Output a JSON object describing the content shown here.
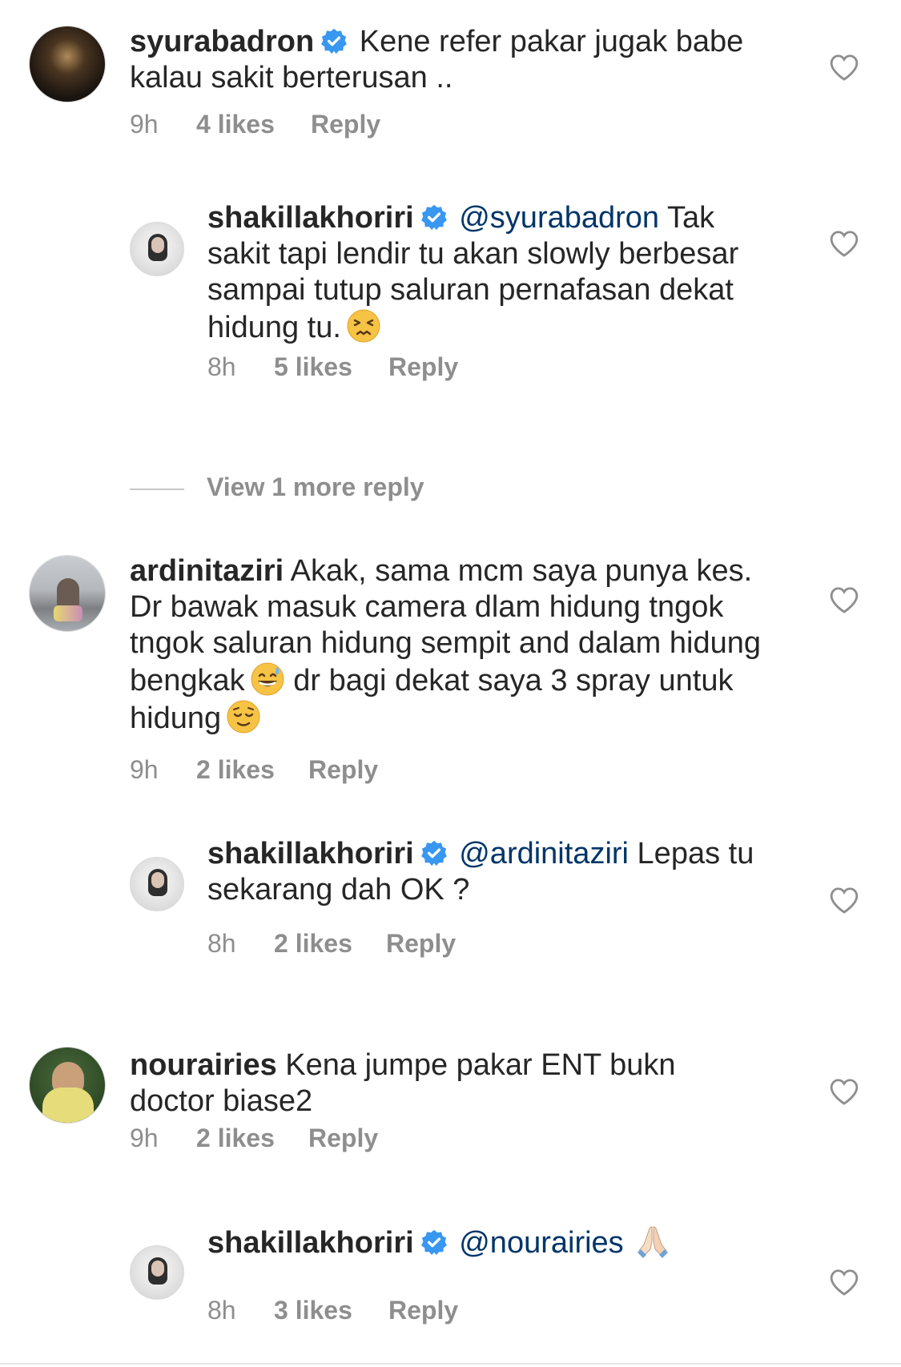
{
  "comments": [
    {
      "id": "c1",
      "level": "top",
      "username": "syurabadron",
      "verified": true,
      "mention": "",
      "text": "Kene refer pakar jugak babe kalau sakit berterusan ..",
      "emoji": "",
      "time": "9h",
      "likes": "4 likes",
      "reply": "Reply",
      "avatar_color": "#2a2118"
    },
    {
      "id": "c2",
      "level": "reply",
      "username": "shakillakhoriri",
      "verified": true,
      "mention": "@syurabadron",
      "text": "Tak sakit tapi lendir tu akan slowly berbesar sampai tutup saluran pernafasan dekat hidung tu.",
      "emoji": "persevering-face",
      "time": "8h",
      "likes": "5 likes",
      "reply": "Reply",
      "avatar_color": "#9a9a9a"
    },
    {
      "id": "c3",
      "level": "top",
      "username": "ardinitaziri",
      "verified": false,
      "mention": "",
      "text": "Akak, sama mcm saya punya kes. Dr bawak masuk camera dlam hidung tngok tngok saluran hidung sempit and dalam hidung bengkak",
      "emoji": "grinning-sweat-face",
      "text2": "dr bagi dekat saya 3 spray untuk hidung",
      "emoji2": "relieved-face",
      "time": "9h",
      "likes": "2 likes",
      "reply": "Reply",
      "avatar_color": "#8a8f96"
    },
    {
      "id": "c4",
      "level": "reply",
      "username": "shakillakhoriri",
      "verified": true,
      "mention": "@ardinitaziri",
      "text": "Lepas tu sekarang dah OK ?",
      "emoji": "",
      "time": "8h",
      "likes": "2 likes",
      "reply": "Reply",
      "avatar_color": "#9a9a9a"
    },
    {
      "id": "c5",
      "level": "top",
      "username": "nourairies",
      "verified": false,
      "mention": "",
      "text": "Kena jumpe pakar ENT bukn doctor biase2",
      "emoji": "",
      "time": "9h",
      "likes": "2 likes",
      "reply": "Reply",
      "avatar_color": "#d8c96a"
    },
    {
      "id": "c6",
      "level": "reply",
      "username": "shakillakhoriri",
      "verified": true,
      "mention": "@nourairies",
      "text": "",
      "emoji": "folded-hands",
      "time": "8h",
      "likes": "3 likes",
      "reply": "Reply",
      "avatar_color": "#9a9a9a"
    }
  ],
  "view_more": "View 1 more reply",
  "colors": {
    "text": "#262626",
    "meta": "#8e8e8e",
    "mention": "#003569",
    "verified": "#3897f0"
  }
}
